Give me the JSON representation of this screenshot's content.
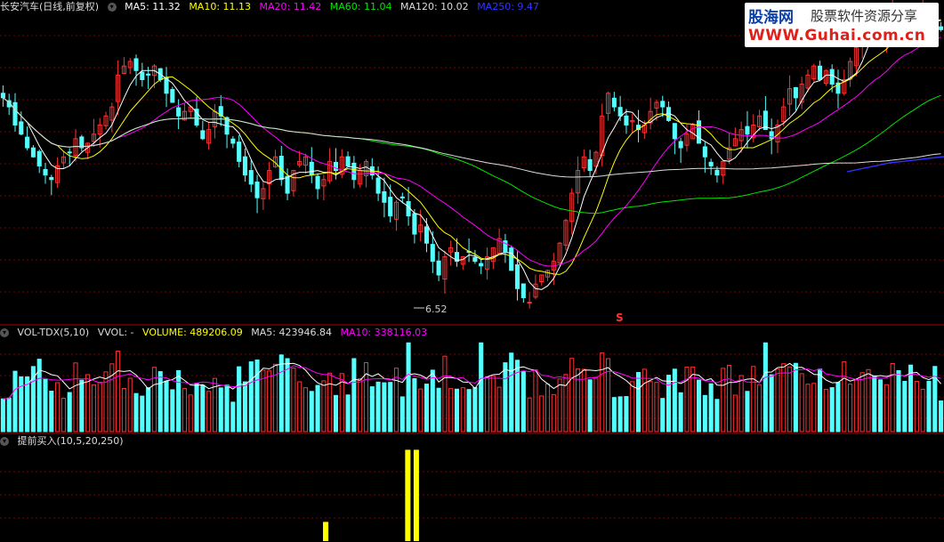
{
  "header": {
    "stock": "长安汽车(日线,前复权)",
    "ma5": "MA5: 11.32",
    "ma10": "MA10: 11.13",
    "ma20": "MA20: 11.42",
    "ma60": "MA60: 11.04",
    "ma120": "MA120: 10.02",
    "ma250": "MA250: 9.47"
  },
  "volume_header": {
    "name": "VOL-TDX(5,10)",
    "vvol": "VVOL: -",
    "volume": "VOLUME: 489206.09",
    "ma5": "MA5: 423946.84",
    "ma10": "MA10: 338116.03"
  },
  "indicator_header": {
    "name": "提前买入(10,5,20,250)"
  },
  "logo": {
    "line1": "股海网",
    "line1b": "股票软件资源分享",
    "line2": "WWW.Guhai.com.cn"
  },
  "colors": {
    "up": "#ff3232",
    "down": "#54ffff",
    "ma5": "#ffffff",
    "ma10": "#ffff00",
    "ma20": "#ff00ff",
    "ma60": "#00e600",
    "ma120": "#dddddd",
    "ma250": "#3333ff",
    "signal": "#ffff00",
    "grid": "#7a0000"
  },
  "chart_data": {
    "type": "candlestick",
    "low_label": "6.52",
    "marker": "S",
    "price_range": [
      6.3,
      13.0
    ],
    "closes": [
      11.2,
      11.0,
      10.6,
      10.4,
      10.1,
      9.9,
      9.7,
      9.5,
      9.4,
      9.7,
      9.9,
      10.0,
      10.3,
      10.1,
      10.2,
      10.4,
      10.6,
      10.8,
      11.0,
      11.7,
      11.9,
      12.0,
      11.8,
      11.6,
      11.7,
      11.9,
      11.6,
      11.3,
      11.1,
      10.8,
      10.9,
      11.0,
      10.6,
      10.3,
      10.5,
      10.9,
      10.8,
      10.4,
      10.2,
      9.8,
      9.5,
      9.3,
      9.0,
      9.2,
      9.6,
      9.9,
      9.4,
      9.1,
      9.6,
      9.8,
      9.9,
      9.5,
      9.2,
      9.4,
      9.8,
      9.6,
      9.9,
      9.7,
      9.4,
      9.6,
      9.8,
      9.5,
      9.1,
      8.9,
      8.6,
      8.9,
      9.0,
      8.6,
      8.2,
      8.4,
      8.0,
      7.6,
      7.3,
      7.7,
      7.9,
      7.6,
      7.7,
      7.8,
      7.6,
      7.5,
      7.7,
      7.9,
      8.1,
      7.8,
      7.4,
      7.0,
      6.8,
      6.7,
      7.1,
      7.3,
      7.4,
      7.6,
      8.0,
      8.5,
      9.1,
      9.6,
      9.9,
      9.6,
      10.0,
      10.8,
      11.3,
      11.0,
      10.8,
      10.6,
      10.7,
      10.5,
      10.6,
      10.9,
      11.1,
      11.0,
      10.7,
      10.3,
      10.1,
      10.4,
      10.6,
      10.2,
      9.9,
      9.7,
      9.5,
      9.8,
      10.1,
      10.3,
      10.5,
      10.4,
      10.6,
      10.8,
      10.5,
      10.3,
      10.6,
      11.0,
      11.4,
      11.2,
      11.5,
      11.7,
      11.9,
      11.6,
      11.8,
      11.5,
      11.3,
      11.6,
      12.0,
      12.3,
      12.8,
      13.0,
      12.9,
      12.5,
      12.8,
      13.1,
      13.0,
      12.9,
      12.6,
      12.9,
      13.2,
      13.0,
      12.8,
      12.7
    ],
    "volume_range": [
      0,
      1000000
    ],
    "volume_last": 489206.09,
    "signal_bars": [
      {
        "pos": 0.345,
        "height": 0.2
      },
      {
        "pos": 0.432,
        "height": 0.95
      },
      {
        "pos": 0.441,
        "height": 0.95
      }
    ]
  }
}
